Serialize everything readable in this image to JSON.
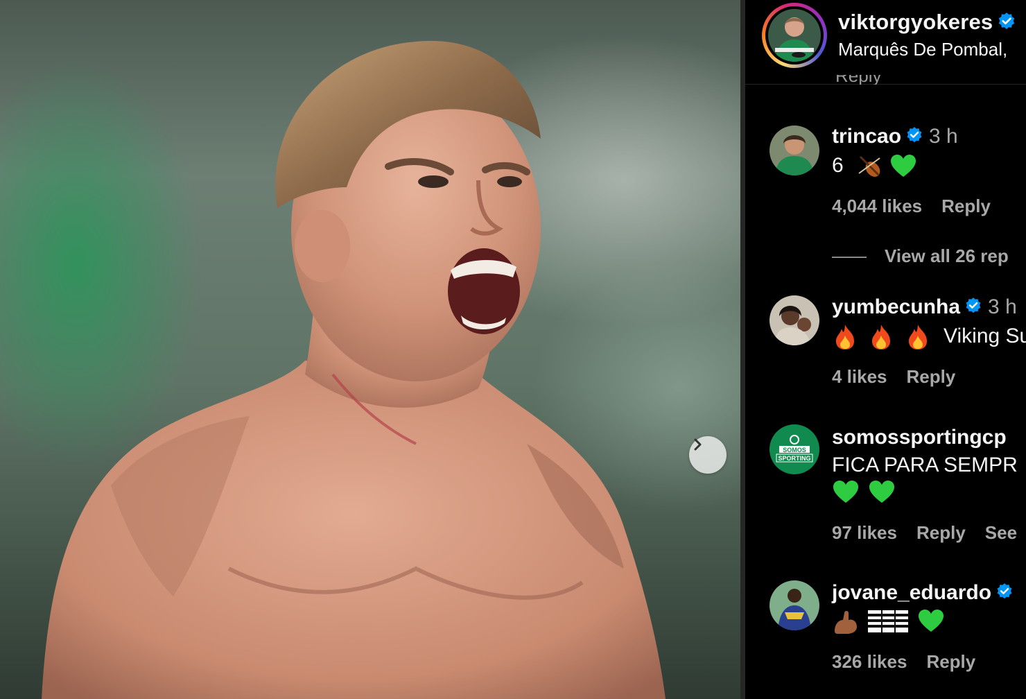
{
  "post": {
    "owner": {
      "username": "viktorgyokeres",
      "location": "Marquês De Pombal,",
      "verified": true,
      "avatar_icon": "profile-photo-green-jersey"
    },
    "photo": {
      "next_icon": "chevron-right-icon"
    },
    "previous_comment_partial": "Reply"
  },
  "comments": [
    {
      "username": "trincao",
      "verified": true,
      "time": "3 h",
      "text": "6",
      "emojis": [
        "violin-emoji",
        "green-heart-emoji"
      ],
      "likes": "4,044 likes",
      "reply": "Reply",
      "view_replies": "View all 26 rep"
    },
    {
      "username": "yumbecunha",
      "verified": true,
      "time": "3 h",
      "emojis": [
        "fire-emoji",
        "fire-emoji",
        "fire-emoji"
      ],
      "text": "Viking Su",
      "likes": "4 likes",
      "reply": "Reply"
    },
    {
      "username": "somossportingcp",
      "verified": false,
      "text": "FICA PARA SEMPR",
      "emojis": [
        "green-heart-emoji",
        "green-heart-emoji"
      ],
      "likes": "97 likes",
      "reply": "Reply",
      "see": "See",
      "avatar_text": [
        "SOMOS",
        "SPORTING"
      ]
    },
    {
      "username": "jovane_eduardo",
      "verified": true,
      "emojis": [
        "flexed-biceps-emoji",
        "flag-emoji",
        "green-heart-emoji"
      ],
      "likes": "326 likes",
      "reply": "Reply"
    }
  ],
  "colors": {
    "background": "#000000",
    "primary_text": "#f5f5f5",
    "secondary_text": "#a8a8a8",
    "verified_blue": "#0095f6",
    "sporting_green": "#118a4f",
    "heart_green": "#2ecc40"
  }
}
